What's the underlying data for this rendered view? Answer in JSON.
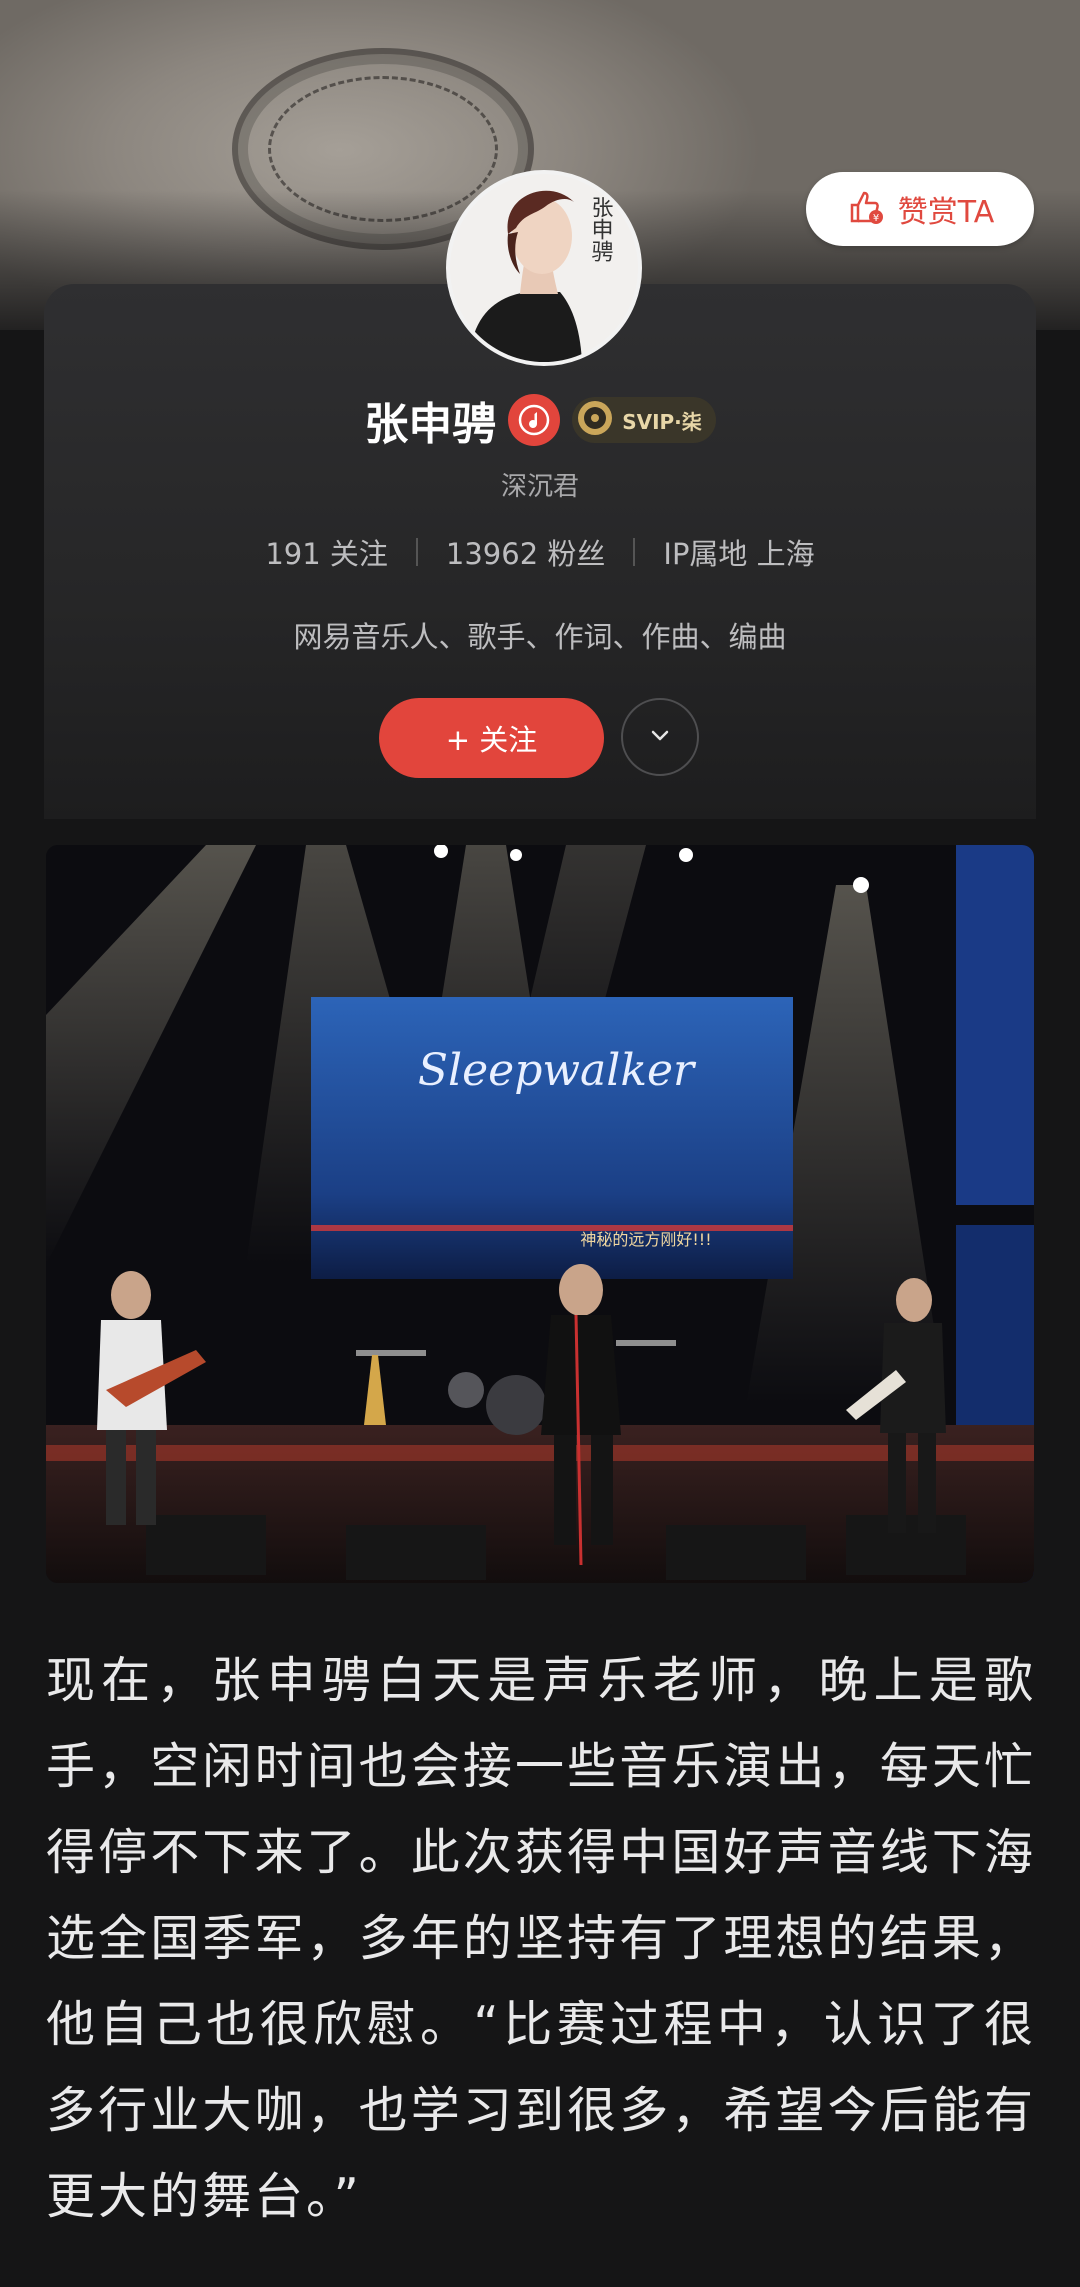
{
  "header": {
    "tip_button_label": "赞赏TA"
  },
  "profile": {
    "avatar_text": "张申骋",
    "name": "张申骋",
    "vip_label": "SVIP·柒",
    "alias": "深沉君",
    "following": "191 关注",
    "followers": "13962 粉丝",
    "ip_location": "IP属地 上海",
    "bio": "网易音乐人、歌手、作词、作曲、编曲",
    "follow_button_label": "+ 关注"
  },
  "photo": {
    "screen_text": "Sleepwalker",
    "screen_subtext": "神秘的远方刚好!!!"
  },
  "article": {
    "text": "现在，张申骋白天是声乐老师，晚上是歌手，空闲时间也会接一些音乐演出，每天忙得停不下来了。此次获得中国好声音线下海选全国季军，多年的坚持有了理想的结果，他自己也很欣慰。“比赛过程中，认识了很多行业大咖，也学习到很多，希望今后能有更大的舞台。”"
  },
  "colors": {
    "accent_red": "#e2453c",
    "background": "#151516",
    "svip_gold": "#e8d7a8"
  },
  "icons": {
    "tip": "thumbs-up-coin-icon",
    "musician": "music-note-badge-icon",
    "vip": "vinyl-disc-icon",
    "more": "chevron-down-icon"
  }
}
